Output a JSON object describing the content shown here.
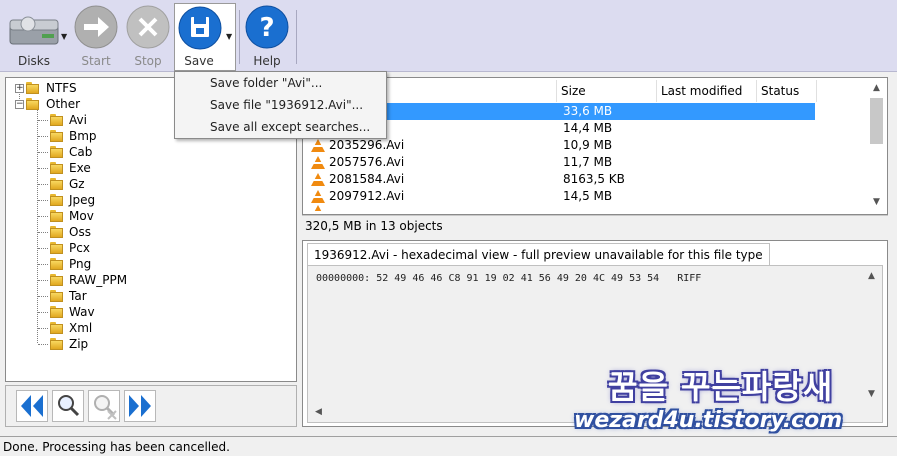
{
  "toolbar": {
    "disks_label": "Disks",
    "start_label": "Start",
    "stop_label": "Stop",
    "save_label": "Save",
    "help_label": "Help"
  },
  "save_menu": {
    "items": [
      "Save folder \"Avi\"...",
      "Save file \"1936912.Avi\"...",
      "Save all except searches..."
    ]
  },
  "tree": {
    "root_items": [
      "NTFS",
      "Other"
    ],
    "children": [
      "Avi",
      "Bmp",
      "Cab",
      "Exe",
      "Gz",
      "Jpeg",
      "Mov",
      "Oss",
      "Pcx",
      "Png",
      "RAW_PPM",
      "Tar",
      "Wav",
      "Xml",
      "Zip"
    ]
  },
  "filelist": {
    "columns": [
      "Size",
      "Last modified",
      "Status"
    ],
    "rows": [
      {
        "name": "",
        "size": "33,6 MB"
      },
      {
        "name": "",
        "size": "14,4 MB"
      },
      {
        "name": "2035296.Avi",
        "size": "10,9 MB"
      },
      {
        "name": "2057576.Avi",
        "size": "11,7 MB"
      },
      {
        "name": "2081584.Avi",
        "size": "8163,5 KB"
      },
      {
        "name": "2097912.Avi",
        "size": "14,5 MB"
      }
    ],
    "summary": "320,5 MB in 13 objects"
  },
  "hexview": {
    "tab_title": "1936912.Avi - hexadecimal view - full preview unavailable for this file type",
    "line": "00000000: 52 49 46 46 C8 91 19 02 41 56 49 20 4C 49 53 54   RIFF"
  },
  "status": {
    "text": "Done. Processing has been cancelled."
  },
  "watermark": {
    "line1": "꿈을 꾸는파랑새",
    "line2": "wezard4u.tistory.com"
  },
  "colors": {
    "toolbar_bg": "#dcdcf0",
    "selection": "#3399ff",
    "button_blue": "#1a6fd0",
    "folder": "#f0c040"
  },
  "icons": [
    "disk-drive-icon",
    "arrow-right-icon",
    "close-x-icon",
    "floppy-save-icon",
    "question-mark-icon",
    "folder-icon",
    "vlc-cone-icon",
    "double-left-arrow-icon",
    "search-magnifier-icon",
    "search-clear-icon",
    "double-right-arrow-icon"
  ]
}
